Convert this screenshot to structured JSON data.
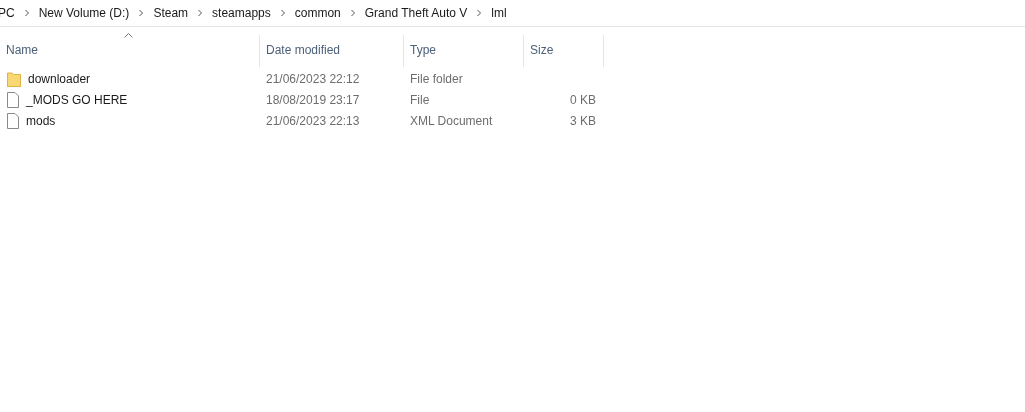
{
  "breadcrumb": [
    "PC",
    "New Volume (D:)",
    "Steam",
    "steamapps",
    "common",
    "Grand Theft Auto V",
    "lml"
  ],
  "table": {
    "columns": [
      {
        "label": "Name",
        "sorted": true
      },
      {
        "label": "Date modified",
        "sorted": false
      },
      {
        "label": "Type",
        "sorted": false
      },
      {
        "label": "Size",
        "sorted": false
      }
    ],
    "rows": [
      {
        "kind": "folder",
        "name": "downloader",
        "date": "21/06/2023 22:12",
        "type": "File folder"
      },
      {
        "kind": "file",
        "name": "_MODS GO HERE",
        "date": "18/08/2019 23:17",
        "type": "File",
        "size": "0 KB"
      },
      {
        "kind": "file",
        "name": "mods",
        "date": "21/06/2023 22:13",
        "type": "XML Document",
        "size": "3 KB"
      }
    ]
  }
}
